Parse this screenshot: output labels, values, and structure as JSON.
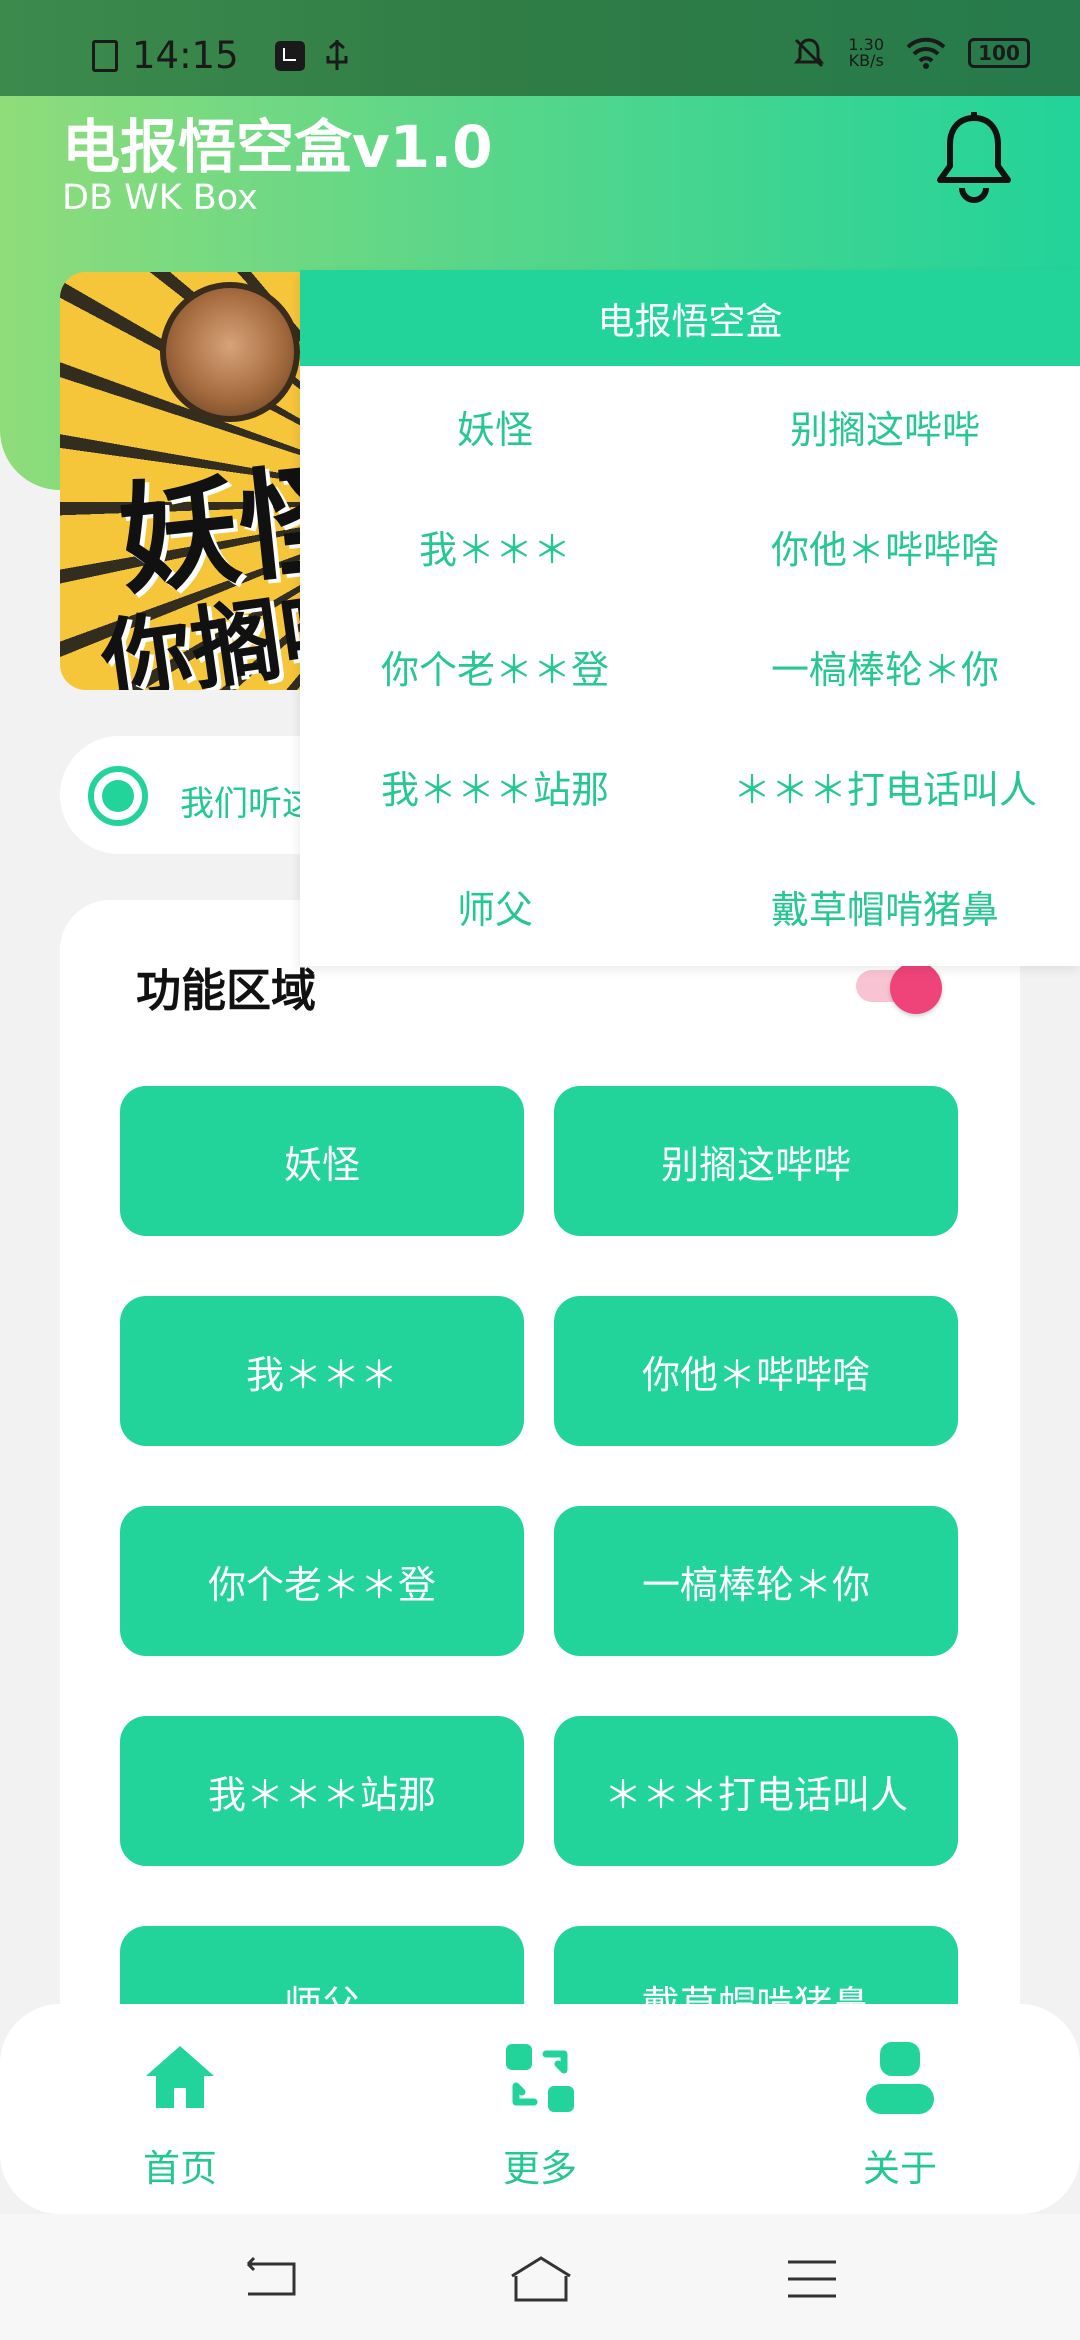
{
  "status_bar": {
    "time": "14:15",
    "speed_value": "1.30",
    "speed_unit": "KB/s",
    "battery": "100",
    "icons": [
      "sim-icon",
      "usb-icon",
      "mute-icon",
      "wifi-icon",
      "battery-icon"
    ]
  },
  "header": {
    "title": "电报悟空盒v1.0",
    "subtitle": "DB WK Box",
    "bell_icon": "bell-icon"
  },
  "banner": {
    "text_line1": "妖怪",
    "text_line2": "你搁哔"
  },
  "notice": {
    "text": "我们听这"
  },
  "panel": {
    "title": "功能区域",
    "toggle_on": true,
    "buttons": [
      "妖怪",
      "别搁这哔哔",
      "我＊＊＊",
      "你他＊哔哔啥",
      "你个老＊＊登",
      "一槁棒轮＊你",
      "我＊＊＊站那",
      "＊＊＊打电话叫人",
      "师父",
      "戴草帽啃猪鼻"
    ]
  },
  "popup": {
    "header": "电报悟空盒",
    "items": [
      "妖怪",
      "别搁这哔哔",
      "我＊＊＊",
      "你他＊哔哔啥",
      "你个老＊＊登",
      "一槁棒轮＊你",
      "我＊＊＊站那",
      "＊＊＊打电话叫人",
      "师父",
      "戴草帽啃猪鼻"
    ]
  },
  "bottom_nav": {
    "items": [
      {
        "label": "首页",
        "icon": "home-icon"
      },
      {
        "label": "更多",
        "icon": "refresh-icon"
      },
      {
        "label": "关于",
        "icon": "user-icon"
      }
    ]
  },
  "colors": {
    "accent": "#22d39a",
    "toggle_thumb": "#ee4479",
    "toggle_track": "#f8c4d3"
  }
}
